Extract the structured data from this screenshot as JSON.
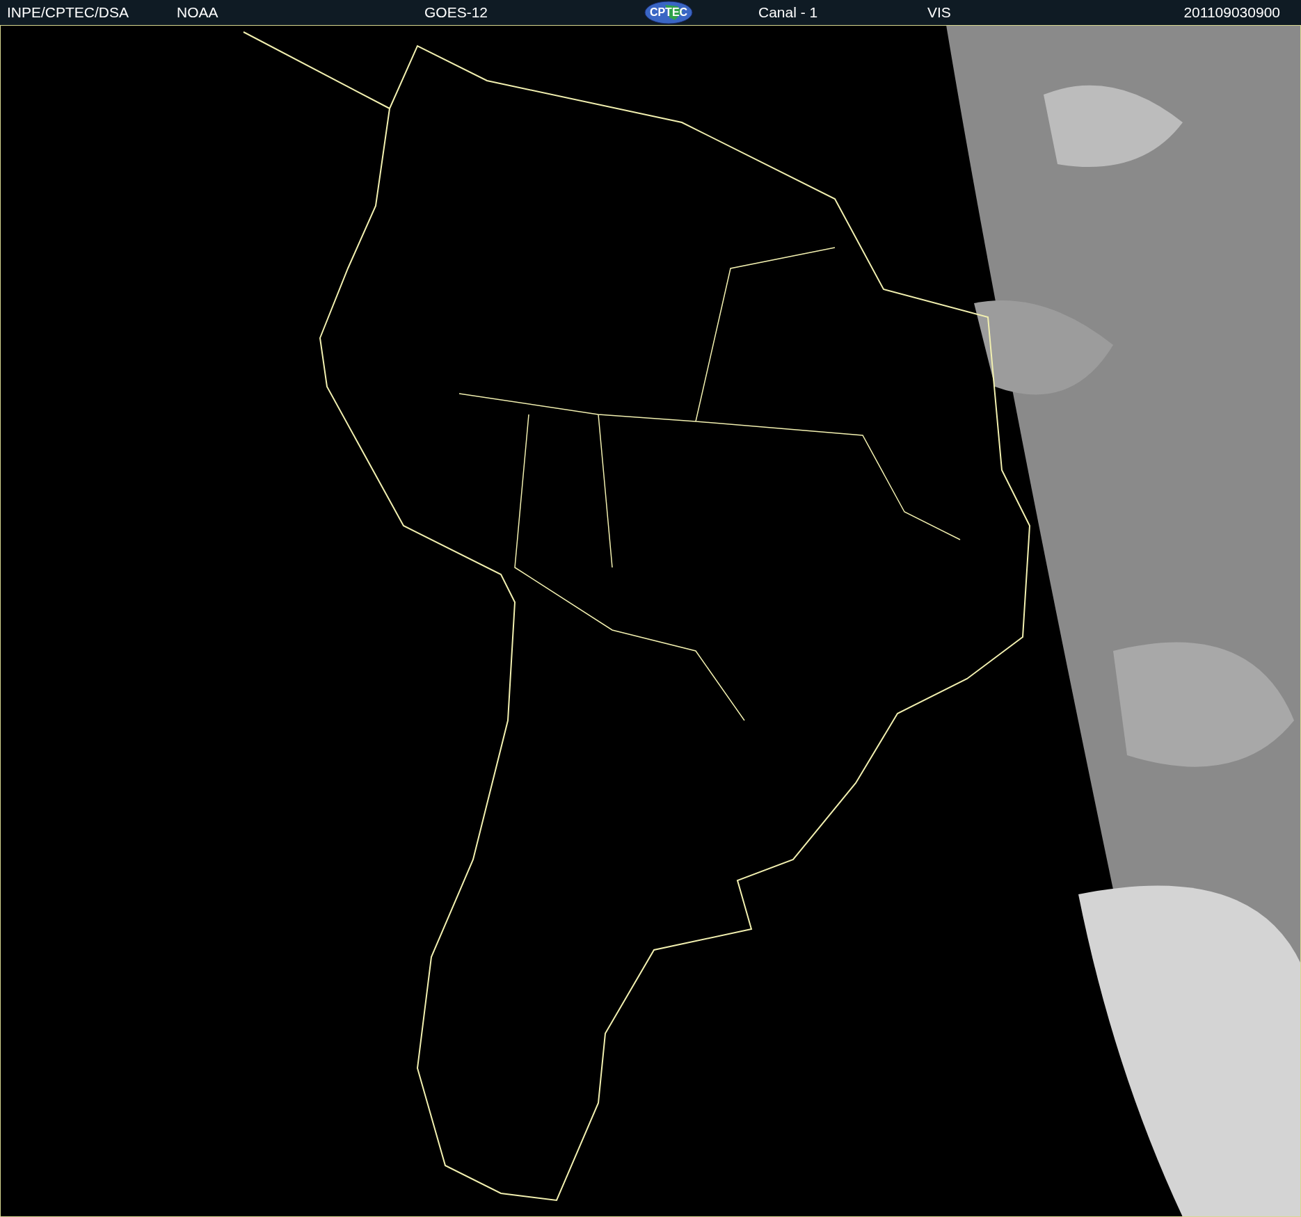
{
  "header": {
    "source": "INPE/CPTEC/DSA",
    "agency": "NOAA",
    "satellite": "GOES-12",
    "logo": "CPTEC",
    "channel": "Canal - 1",
    "band": "VIS",
    "timestamp": "201109030900"
  }
}
